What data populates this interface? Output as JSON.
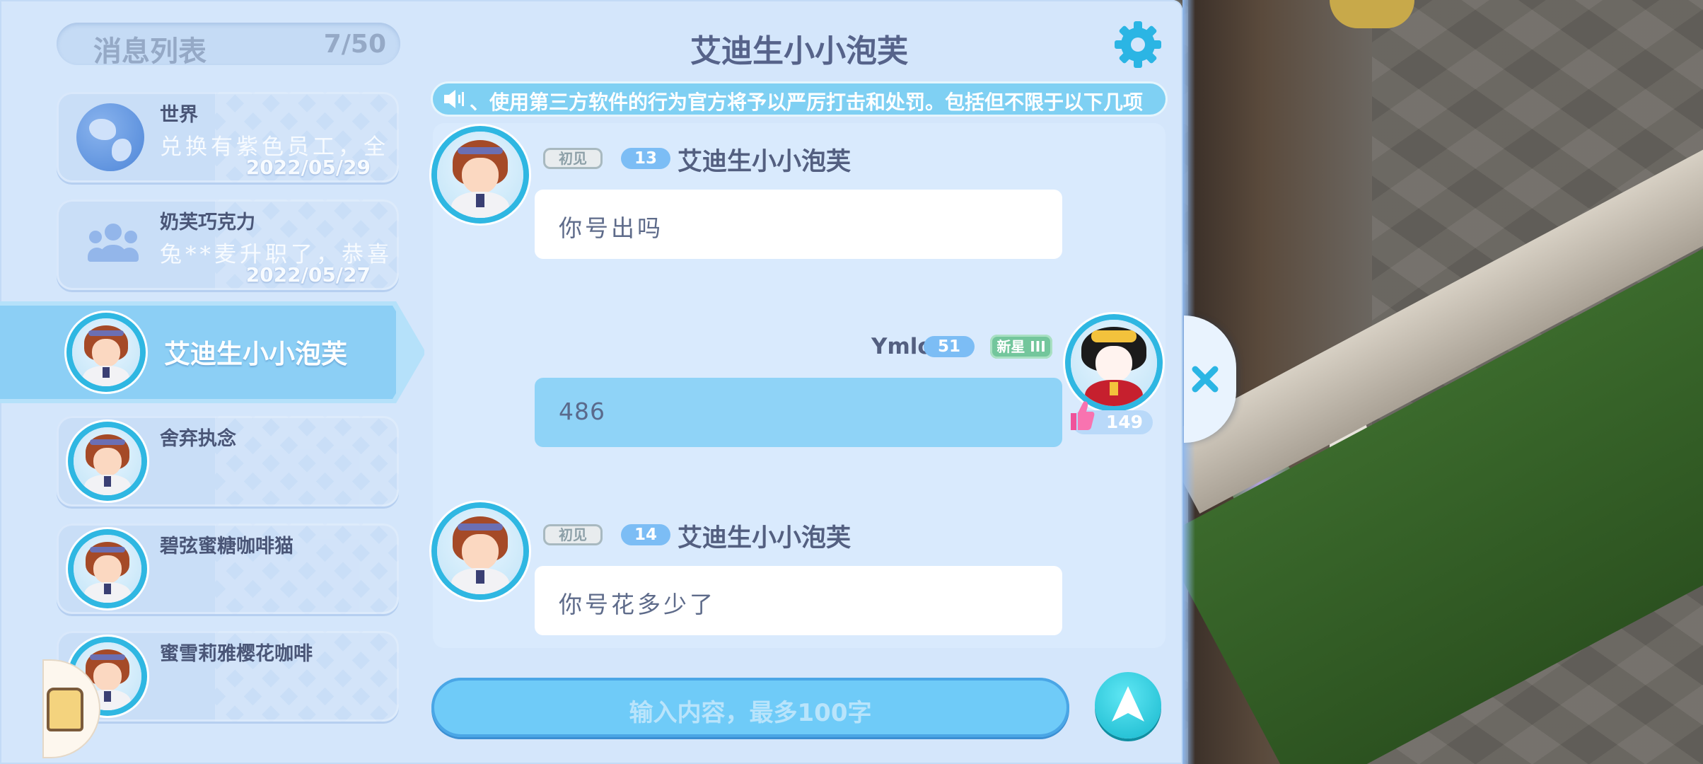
{
  "list": {
    "title": "消息列表",
    "count": "7/50",
    "items": [
      {
        "name": "世界",
        "preview": "兑换有紫色员工，全",
        "date": "2022/05/29",
        "icon": "globe-icon"
      },
      {
        "name": "奶芙巧克力",
        "preview": "兔**麦升职了，恭喜",
        "date": "2022/05/27",
        "icon": "group-icon"
      },
      {
        "name": "艾迪生小小泡芙",
        "selected": true
      },
      {
        "name": "舍弃执念"
      },
      {
        "name": "碧弦蜜糖咖啡猫"
      },
      {
        "name": "蜜雪莉雅樱花咖啡"
      }
    ]
  },
  "chat": {
    "title": "艾迪生小小泡芙",
    "announcement": "、使用第三方软件的行为官方将予以严厉打击和处罚。包括但不限于以下几项",
    "messages": [
      {
        "tag": "初见",
        "level": "13",
        "sender": "艾迪生小小泡芙",
        "text": "你号出吗",
        "mine": false
      },
      {
        "tag": "新星 III",
        "level": "51",
        "sender": "Ymlo",
        "text": "486",
        "mine": true,
        "likes": "149"
      },
      {
        "tag": "初见",
        "level": "14",
        "sender": "艾迪生小小泡芙",
        "text": "你号花多少了",
        "mine": false
      }
    ]
  },
  "input": {
    "placeholder": "输入内容，最多100字"
  },
  "colors": {
    "accent": "#2fb7e2",
    "panel": "#d4e6fb",
    "title": "#56638a",
    "send": "#16b7cd"
  },
  "icons": [
    "gear-icon",
    "speaker-icon",
    "thumb-up-icon",
    "send-icon",
    "close-icon"
  ]
}
